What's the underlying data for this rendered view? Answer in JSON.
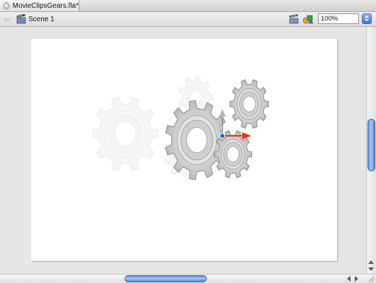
{
  "document": {
    "tab_title": "MovieClipsGears.fla*",
    "close_icon": "close-icon"
  },
  "editbar": {
    "back_icon": "back-arrow-icon",
    "scene_icon": "clapperboard-icon",
    "scene_label": "Scene 1",
    "edit_symbols_icon": "edit-symbols-icon",
    "edit_scene_icon": "edit-scene-icon",
    "zoom_value": "100%"
  },
  "stage": {
    "content": "gear movie clips with transform gizmo"
  },
  "colors": {
    "stage_bg": "#ffffff",
    "pasteboard_bg": "#e6e6e6",
    "scroll_accent": "#4a7fcc",
    "gizmo_x_axis": "#e03a1a",
    "gizmo_center": "#2a63c5"
  }
}
